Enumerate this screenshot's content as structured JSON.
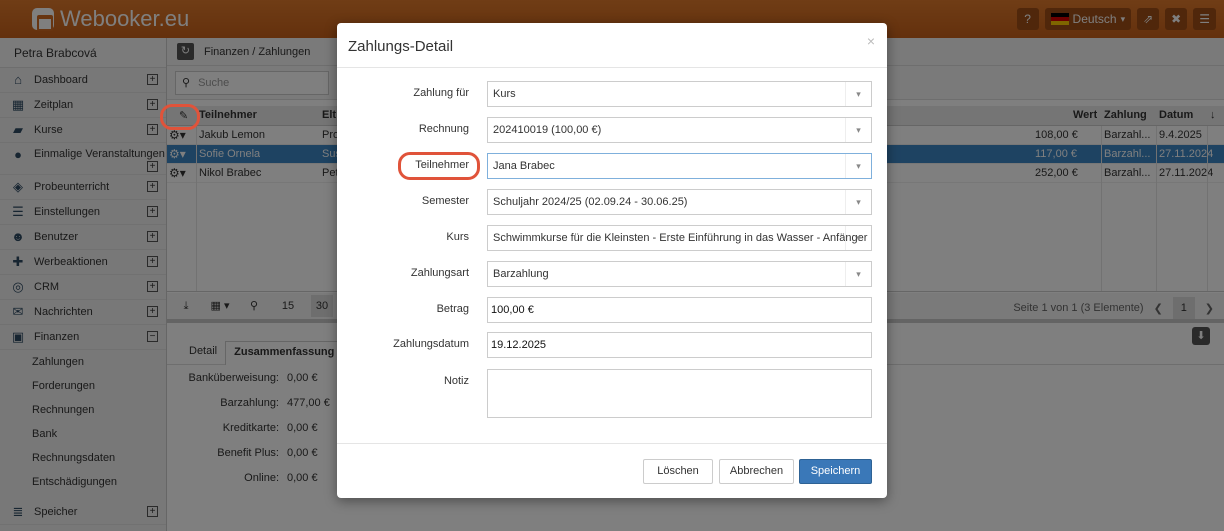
{
  "app": {
    "logo": "Webooker.eu"
  },
  "topbar": {
    "help": "?",
    "language": "Deutsch",
    "lang_caret": "▾",
    "external": "⇗",
    "close": "✖",
    "menu": "☰"
  },
  "sidebar": {
    "user": "Petra Brabcová",
    "items": [
      {
        "icon": "home-icon",
        "glyph": "⌂",
        "label": "Dashboard"
      },
      {
        "icon": "calendar-icon",
        "glyph": "▦",
        "label": "Zeitplan"
      },
      {
        "icon": "book-icon",
        "glyph": "▰",
        "label": "Kurse"
      },
      {
        "icon": "soccer-ball-icon",
        "glyph": "●",
        "label": "Einmalige Veranstaltungen"
      },
      {
        "icon": "trial-icon",
        "glyph": "◈",
        "label": "Probeunterricht"
      },
      {
        "icon": "settings-icon",
        "glyph": "☰",
        "label": "Einstellungen"
      },
      {
        "icon": "users-icon",
        "glyph": "☻",
        "label": "Benutzer"
      },
      {
        "icon": "gift-icon",
        "glyph": "✚",
        "label": "Werbeaktionen"
      },
      {
        "icon": "crm-icon",
        "glyph": "◎",
        "label": "CRM"
      },
      {
        "icon": "mail-icon",
        "glyph": "✉",
        "label": "Nachrichten"
      },
      {
        "icon": "finance-icon",
        "glyph": "▣",
        "label": "Finanzen"
      }
    ],
    "finance_sub": [
      "Zahlungen",
      "Forderungen",
      "Rechnungen",
      "Bank",
      "Rechnungsdaten",
      "Entschädigungen"
    ],
    "last": {
      "icon": "storage-icon",
      "glyph": "≣",
      "label": "Speicher"
    }
  },
  "main": {
    "breadcrumb": "Finanzen / Zahlungen",
    "search_placeholder": "Suche",
    "columns": {
      "teilnehmer": "Teilnehmer",
      "eltern": "Elt",
      "wert": "Wert",
      "zahlung": "Zahlung",
      "datum": "Datum",
      "sort": "↓"
    },
    "rows": [
      {
        "name": "Jakub Lemon",
        "eltern": "Pro",
        "wert": "108,00 €",
        "zahlung": "Barzahl...",
        "datum": "9.4.2025"
      },
      {
        "name": "Sofie Ornela",
        "eltern": "Sus",
        "wert": "117,00 €",
        "zahlung": "Barzahl...",
        "datum": "27.11.2024"
      },
      {
        "name": "Nikol Brabec",
        "eltern": "Pet",
        "wert": "252,00 €",
        "zahlung": "Barzahl...",
        "datum": "27.11.2024"
      }
    ],
    "pager": {
      "page_size_a": "15",
      "page_size_b": "30",
      "info": "Seite 1 von 1 (3 Elemente)",
      "page": "1",
      "prev": "❮",
      "next": "❯"
    },
    "tabs": [
      "Detail",
      "Zusammenfassung"
    ],
    "summary": [
      {
        "label": "Banküberweisung:",
        "value": "0,00 €"
      },
      {
        "label": "Barzahlung:",
        "value": "477,00 €"
      },
      {
        "label": "Kreditkarte:",
        "value": "0,00 €"
      },
      {
        "label": "Benefit Plus:",
        "value": "0,00 €"
      },
      {
        "label": "Online:",
        "value": "0,00 €"
      }
    ]
  },
  "modal": {
    "title": "Zahlungs-Detail",
    "close": "×",
    "fields": {
      "zahlung_fuer": {
        "label": "Zahlung für",
        "value": "Kurs"
      },
      "rechnung": {
        "label": "Rechnung",
        "value": "202410019 (100,00 €)"
      },
      "teilnehmer": {
        "label": "Teilnehmer",
        "value": "Jana Brabec"
      },
      "semester": {
        "label": "Semester",
        "value": "Schuljahr 2024/25 (02.09.24 - 30.06.25)"
      },
      "kurs": {
        "label": "Kurs",
        "value": "Schwimmkurse für die Kleinsten - Erste Einführung in das Wasser - Anfänger"
      },
      "zahlungsart": {
        "label": "Zahlungsart",
        "value": "Barzahlung"
      },
      "betrag": {
        "label": "Betrag",
        "value": "100,00 €"
      },
      "zahlungsdatum": {
        "label": "Zahlungsdatum",
        "value": "19.12.2025"
      },
      "notiz": {
        "label": "Notiz",
        "value": ""
      }
    },
    "buttons": {
      "delete": "Löschen",
      "cancel": "Abbrechen",
      "save": "Speichern"
    }
  },
  "colors": {
    "brand": "#d06a22",
    "selected_row": "#3c86c4",
    "primary_button": "#3a78b8",
    "highlight": "#e0533a"
  }
}
